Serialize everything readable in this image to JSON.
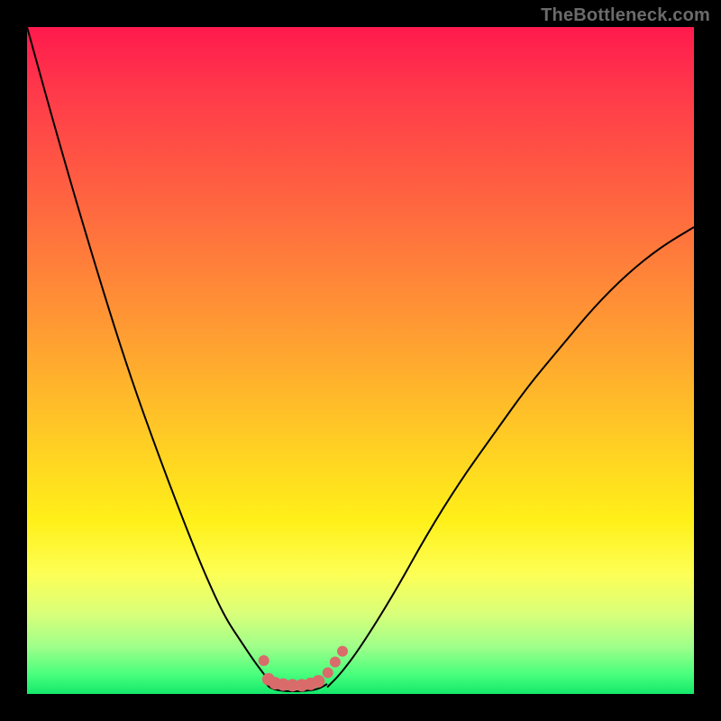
{
  "watermark": "TheBottleneck.com",
  "chart_data": {
    "type": "line",
    "title": "",
    "xlabel": "",
    "ylabel": "",
    "xlim": [
      0,
      100
    ],
    "ylim": [
      0,
      100
    ],
    "series": [
      {
        "name": "left-curve",
        "x": [
          0,
          5,
          10,
          15,
          20,
          25,
          28,
          30,
          32,
          34,
          35.5,
          37
        ],
        "y": [
          100,
          82,
          65,
          49,
          35,
          22,
          15,
          11,
          8,
          5,
          3,
          1
        ]
      },
      {
        "name": "right-curve",
        "x": [
          45,
          47,
          50,
          55,
          60,
          65,
          70,
          75,
          80,
          85,
          90,
          95,
          100
        ],
        "y": [
          1,
          3,
          7,
          15,
          24,
          32,
          39,
          46,
          52,
          58,
          63,
          67,
          70
        ]
      },
      {
        "name": "bottom-connector",
        "x": [
          35.5,
          36,
          37,
          38,
          39,
          40,
          41,
          42,
          43,
          44,
          45
        ],
        "y": [
          2.5,
          1.2,
          0.7,
          0.5,
          0.4,
          0.4,
          0.4,
          0.5,
          0.6,
          0.9,
          1.5
        ]
      }
    ],
    "markers": [
      {
        "x": 35.5,
        "y": 5.0,
        "r": 6
      },
      {
        "x": 36.2,
        "y": 2.2,
        "r": 7
      },
      {
        "x": 37.2,
        "y": 1.6,
        "r": 7
      },
      {
        "x": 38.4,
        "y": 1.4,
        "r": 7
      },
      {
        "x": 39.8,
        "y": 1.3,
        "r": 7
      },
      {
        "x": 41.2,
        "y": 1.3,
        "r": 7
      },
      {
        "x": 42.5,
        "y": 1.5,
        "r": 7
      },
      {
        "x": 43.7,
        "y": 1.9,
        "r": 7
      },
      {
        "x": 45.1,
        "y": 3.2,
        "r": 6
      },
      {
        "x": 46.2,
        "y": 4.8,
        "r": 6
      },
      {
        "x": 47.3,
        "y": 6.4,
        "r": 6
      }
    ],
    "marker_color": "#d96b6b",
    "curve_color": "#000000"
  }
}
